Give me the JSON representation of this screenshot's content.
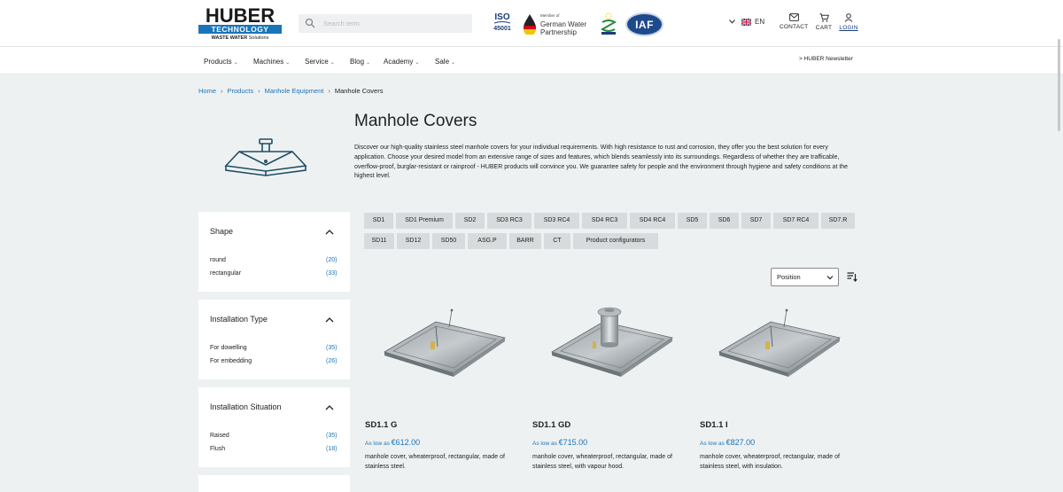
{
  "header": {
    "logo_main": "HUBER",
    "logo_sub": "TECHNOLOGY",
    "logo_tagline_bold": "WASTE WATER",
    "logo_tagline": " Solutions",
    "search_placeholder": "Search term",
    "iso_label": "ISO",
    "iso_number": "45001",
    "gwp_member": "Member of",
    "gwp_name": "German Water Partnership",
    "iaf_label": "IAF",
    "language": "EN",
    "contact_label": "CONTACT",
    "cart_label": "CART",
    "login_label": "LOGIN"
  },
  "nav": {
    "items": [
      {
        "label": "Products"
      },
      {
        "label": "Machines"
      },
      {
        "label": "Service"
      },
      {
        "label": "Blog"
      },
      {
        "label": "Academy"
      },
      {
        "label": "Sale"
      }
    ],
    "newsletter": "> HUBER Newsletter"
  },
  "breadcrumb": {
    "home": "Home",
    "products": "Products",
    "equipment": "Manhole Equipment",
    "current": "Manhole Covers"
  },
  "page": {
    "title": "Manhole Covers",
    "description": "Discover our high-quality stainless steel manhole covers for your individual requirements. With high resistance to rust and corrosion, they offer you the best solution for every application. Choose your desired model from an extensive range of sizes and features, which blends seamlessly into its surroundings. Regardless of whether they are trafficable, overflow-proof, burglar-resistant or rainproof - HUBER products will convince you. We guarantee safety for people and the environment through hygiene and safety conditions at the highest level."
  },
  "chips": [
    "SD1",
    "SD1 Premium",
    "SD2",
    "SD3 RC3",
    "SD3 RC4",
    "SD4 RC3",
    "SD4 RC4",
    "SD5",
    "SD6",
    "SD7",
    "SD7 RC4",
    "SD7.R",
    "SD11",
    "SD12",
    "SD50",
    "ASG.P",
    "BARR",
    "CT",
    "Product configurators"
  ],
  "sort": {
    "selected": "Position"
  },
  "filters": [
    {
      "title": "Shape",
      "options": [
        {
          "label": "round",
          "count": "(20)"
        },
        {
          "label": "rectangular",
          "count": "(33)"
        }
      ]
    },
    {
      "title": "Installation Type",
      "options": [
        {
          "label": "For dowelling",
          "count": "(35)"
        },
        {
          "label": "For embedding",
          "count": "(26)"
        }
      ]
    },
    {
      "title": "Installation Situation",
      "options": [
        {
          "label": "Raised",
          "count": "(35)"
        },
        {
          "label": "Flush",
          "count": "(18)"
        }
      ]
    }
  ],
  "products": [
    {
      "name": "SD1.1 G",
      "price_prefix": "As low as ",
      "price": "€612.00",
      "description": "manhole cover, wheaterproof, rectangular, made of stainless steel."
    },
    {
      "name": "SD1.1 GD",
      "price_prefix": "As low as ",
      "price": "€715.00",
      "description": "manhole cover, wheaterproof, rectangular, made of stainless steel, with vapour hood."
    },
    {
      "name": "SD1.1 I",
      "price_prefix": "As low as ",
      "price": "€827.00",
      "description": "manhole cover, wheaterproof, rectangular, made of stainless steel, with insulation."
    }
  ],
  "colors": {
    "brand_blue": "#1a74b9",
    "page_bg": "#eef1f2",
    "chip_bg": "#d8dbdd"
  }
}
